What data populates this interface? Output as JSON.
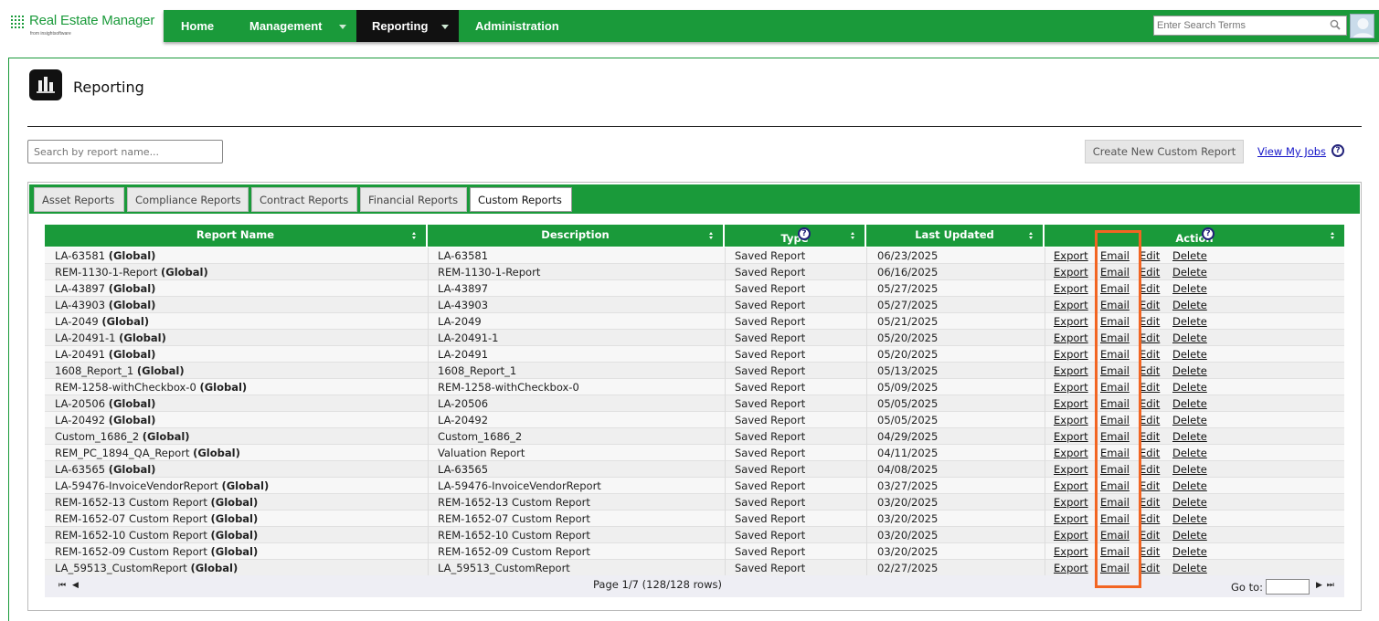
{
  "app": {
    "name": "Real Estate Manager",
    "subtitle": "from insightsoftware"
  },
  "nav": {
    "items": [
      {
        "label": "Home",
        "dropdown": false,
        "active": false
      },
      {
        "label": "Management",
        "dropdown": true,
        "active": false
      },
      {
        "label": "Reporting",
        "dropdown": true,
        "active": true
      },
      {
        "label": "Administration",
        "dropdown": false,
        "active": false
      }
    ],
    "search_placeholder": "Enter Search Terms"
  },
  "page": {
    "title": "Reporting",
    "search_placeholder": "Search by report name...",
    "create_button": "Create New Custom Report",
    "view_jobs": "View My Jobs"
  },
  "tabs": [
    {
      "label": "Asset Reports",
      "active": false
    },
    {
      "label": "Compliance Reports",
      "active": false
    },
    {
      "label": "Contract Reports",
      "active": false
    },
    {
      "label": "Financial Reports",
      "active": false
    },
    {
      "label": "Custom Reports",
      "active": true
    }
  ],
  "table": {
    "columns": [
      "Report Name",
      "Description",
      "Type",
      "Last Updated",
      "Action"
    ],
    "global_suffix": "(Global)",
    "actions": [
      "Export",
      "Email",
      "Edit",
      "Delete"
    ],
    "rows": [
      {
        "name": "LA-63581",
        "description": "LA-63581",
        "type": "Saved Report",
        "updated": "06/23/2025"
      },
      {
        "name": "REM-1130-1-Report",
        "description": "REM-1130-1-Report",
        "type": "Saved Report",
        "updated": "06/16/2025"
      },
      {
        "name": "LA-43897",
        "description": "LA-43897",
        "type": "Saved Report",
        "updated": "05/27/2025"
      },
      {
        "name": "LA-43903",
        "description": "LA-43903",
        "type": "Saved Report",
        "updated": "05/27/2025"
      },
      {
        "name": "LA-2049",
        "description": "LA-2049",
        "type": "Saved Report",
        "updated": "05/21/2025"
      },
      {
        "name": "LA-20491-1",
        "description": "LA-20491-1",
        "type": "Saved Report",
        "updated": "05/20/2025"
      },
      {
        "name": "LA-20491",
        "description": "LA-20491",
        "type": "Saved Report",
        "updated": "05/20/2025"
      },
      {
        "name": "1608_Report_1",
        "description": "1608_Report_1",
        "type": "Saved Report",
        "updated": "05/13/2025"
      },
      {
        "name": "REM-1258-withCheckbox-0",
        "description": "REM-1258-withCheckbox-0",
        "type": "Saved Report",
        "updated": "05/09/2025"
      },
      {
        "name": "LA-20506",
        "description": "LA-20506",
        "type": "Saved Report",
        "updated": "05/05/2025"
      },
      {
        "name": "LA-20492",
        "description": "LA-20492",
        "type": "Saved Report",
        "updated": "05/05/2025"
      },
      {
        "name": "Custom_1686_2",
        "description": "Custom_1686_2",
        "type": "Saved Report",
        "updated": "04/29/2025"
      },
      {
        "name": "REM_PC_1894_QA_Report",
        "description": "Valuation Report",
        "type": "Saved Report",
        "updated": "04/11/2025"
      },
      {
        "name": "LA-63565",
        "description": "LA-63565",
        "type": "Saved Report",
        "updated": "04/08/2025"
      },
      {
        "name": "LA-59476-InvoiceVendorReport",
        "description": "LA-59476-InvoiceVendorReport",
        "type": "Saved Report",
        "updated": "03/27/2025"
      },
      {
        "name": "REM-1652-13 Custom Report",
        "description": "REM-1652-13 Custom Report",
        "type": "Saved Report",
        "updated": "03/20/2025"
      },
      {
        "name": "REM-1652-07 Custom Report",
        "description": "REM-1652-07 Custom Report",
        "type": "Saved Report",
        "updated": "03/20/2025"
      },
      {
        "name": "REM-1652-10 Custom Report",
        "description": "REM-1652-10 Custom Report",
        "type": "Saved Report",
        "updated": "03/20/2025"
      },
      {
        "name": "REM-1652-09 Custom Report",
        "description": "REM-1652-09 Custom Report",
        "type": "Saved Report",
        "updated": "03/20/2025"
      },
      {
        "name": "LA_59513_CustomReport",
        "description": "LA_59513_CustomReport",
        "type": "Saved Report",
        "updated": "02/27/2025"
      }
    ]
  },
  "pager": {
    "info": "Page 1/7 (128/128 rows)",
    "goto_label": "Go to:",
    "first": "⏮",
    "prev": "◀",
    "next": "▶",
    "last": "⏭"
  },
  "colors": {
    "brand_green": "#1a9a3a",
    "highlight": "#f26522",
    "link_blue": "#1414c8"
  },
  "icons": {
    "search": "magnifier-icon",
    "help": "help-icon",
    "report": "reporting-icon"
  }
}
